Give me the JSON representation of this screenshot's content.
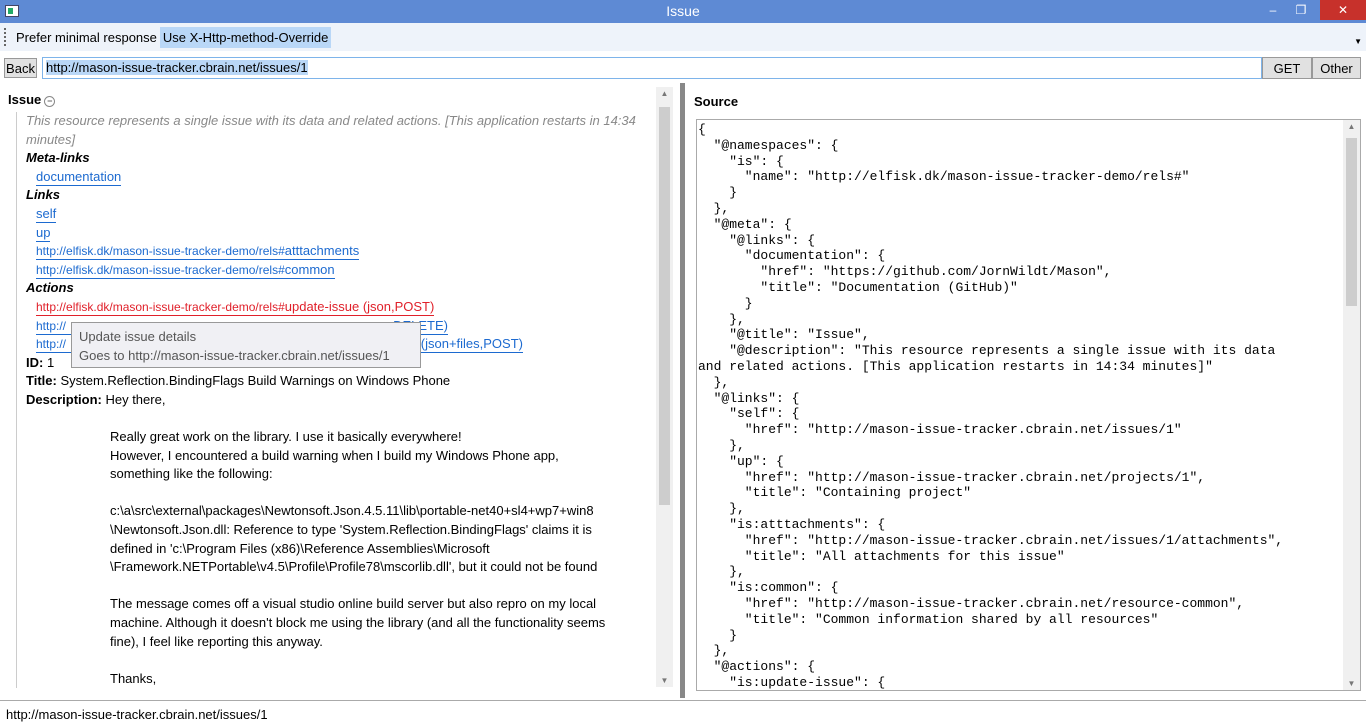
{
  "window": {
    "title": "Issue",
    "minimize": "‒",
    "restore": "❐",
    "close": "✕"
  },
  "toolbar": {
    "prefer_minimal": "Prefer minimal response",
    "override": "Use X-Http-method-Override"
  },
  "address": {
    "back": "Back",
    "url": "http://mason-issue-tracker.cbrain.net/issues/1",
    "get": "GET",
    "other": "Other"
  },
  "left": {
    "title": "Issue",
    "description": "This resource represents a single issue with its data and related actions. [This application restarts in 14:34 minutes]",
    "meta_title": "Meta-links",
    "meta_links": [
      "documentation"
    ],
    "links_title": "Links",
    "links": [
      "self",
      "up"
    ],
    "ns_links": [
      {
        "prefix": "http://elfisk.dk/mason-issue-tracker-demo/rels#",
        "name": "atttachments"
      },
      {
        "prefix": "http://elfisk.dk/mason-issue-tracker-demo/rels#",
        "name": "common"
      }
    ],
    "actions_title": "Actions",
    "actions": [
      {
        "prefix": "http://elfisk.dk/mason-issue-tracker-demo/rels#",
        "name": "update-issue (json,POST)"
      },
      {
        "prefix": "http://",
        "name": "…,DELETE)"
      },
      {
        "prefix": "http://",
        "name": "…(json+files,POST)"
      }
    ],
    "id_label": "ID:",
    "id": "1",
    "title_label": "Title:",
    "title_value": "System.Reflection.BindingFlags Build Warnings on Windows Phone",
    "desc_label": "Description:",
    "desc_first": "Hey there,",
    "desc_body": "\nReally great work on the library. I use it basically everywhere!\nHowever, I encountered a build warning when I build my Windows Phone app,\nsomething like the following:\n\nc:\\a\\src\\external\\packages\\Newtonsoft.Json.4.5.11\\lib\\portable-net40+sl4+wp7+win8\n\\Newtonsoft.Json.dll: Reference to type 'System.Reflection.BindingFlags' claims it is\ndefined in 'c:\\Program Files (x86)\\Reference Assemblies\\Microsoft\n\\Framework.NETPortable\\v4.5\\Profile\\Profile78\\mscorlib.dll', but it could not be found\n\nThe message comes off a visual studio online build server but also repro on my local\nmachine. Although it doesn't block me using the library (and all the functionality seems\nfine), I feel like reporting this anyway.\n\nThanks,",
    "tooltip": {
      "line1": "Update issue details",
      "line2": "Goes to http://mason-issue-tracker.cbrain.net/issues/1"
    }
  },
  "right": {
    "title": "Source",
    "code": "{\n  \"@namespaces\": {\n    \"is\": {\n      \"name\": \"http://elfisk.dk/mason-issue-tracker-demo/rels#\"\n    }\n  },\n  \"@meta\": {\n    \"@links\": {\n      \"documentation\": {\n        \"href\": \"https://github.com/JornWildt/Mason\",\n        \"title\": \"Documentation (GitHub)\"\n      }\n    },\n    \"@title\": \"Issue\",\n    \"@description\": \"This resource represents a single issue with its data\nand related actions. [This application restarts in 14:34 minutes]\"\n  },\n  \"@links\": {\n    \"self\": {\n      \"href\": \"http://mason-issue-tracker.cbrain.net/issues/1\"\n    },\n    \"up\": {\n      \"href\": \"http://mason-issue-tracker.cbrain.net/projects/1\",\n      \"title\": \"Containing project\"\n    },\n    \"is:atttachments\": {\n      \"href\": \"http://mason-issue-tracker.cbrain.net/issues/1/attachments\",\n      \"title\": \"All attachments for this issue\"\n    },\n    \"is:common\": {\n      \"href\": \"http://mason-issue-tracker.cbrain.net/resource-common\",\n      \"title\": \"Common information shared by all resources\"\n    }\n  },\n  \"@actions\": {\n    \"is:update-issue\": {"
  },
  "status": {
    "url": "http://mason-issue-tracker.cbrain.net/issues/1"
  }
}
